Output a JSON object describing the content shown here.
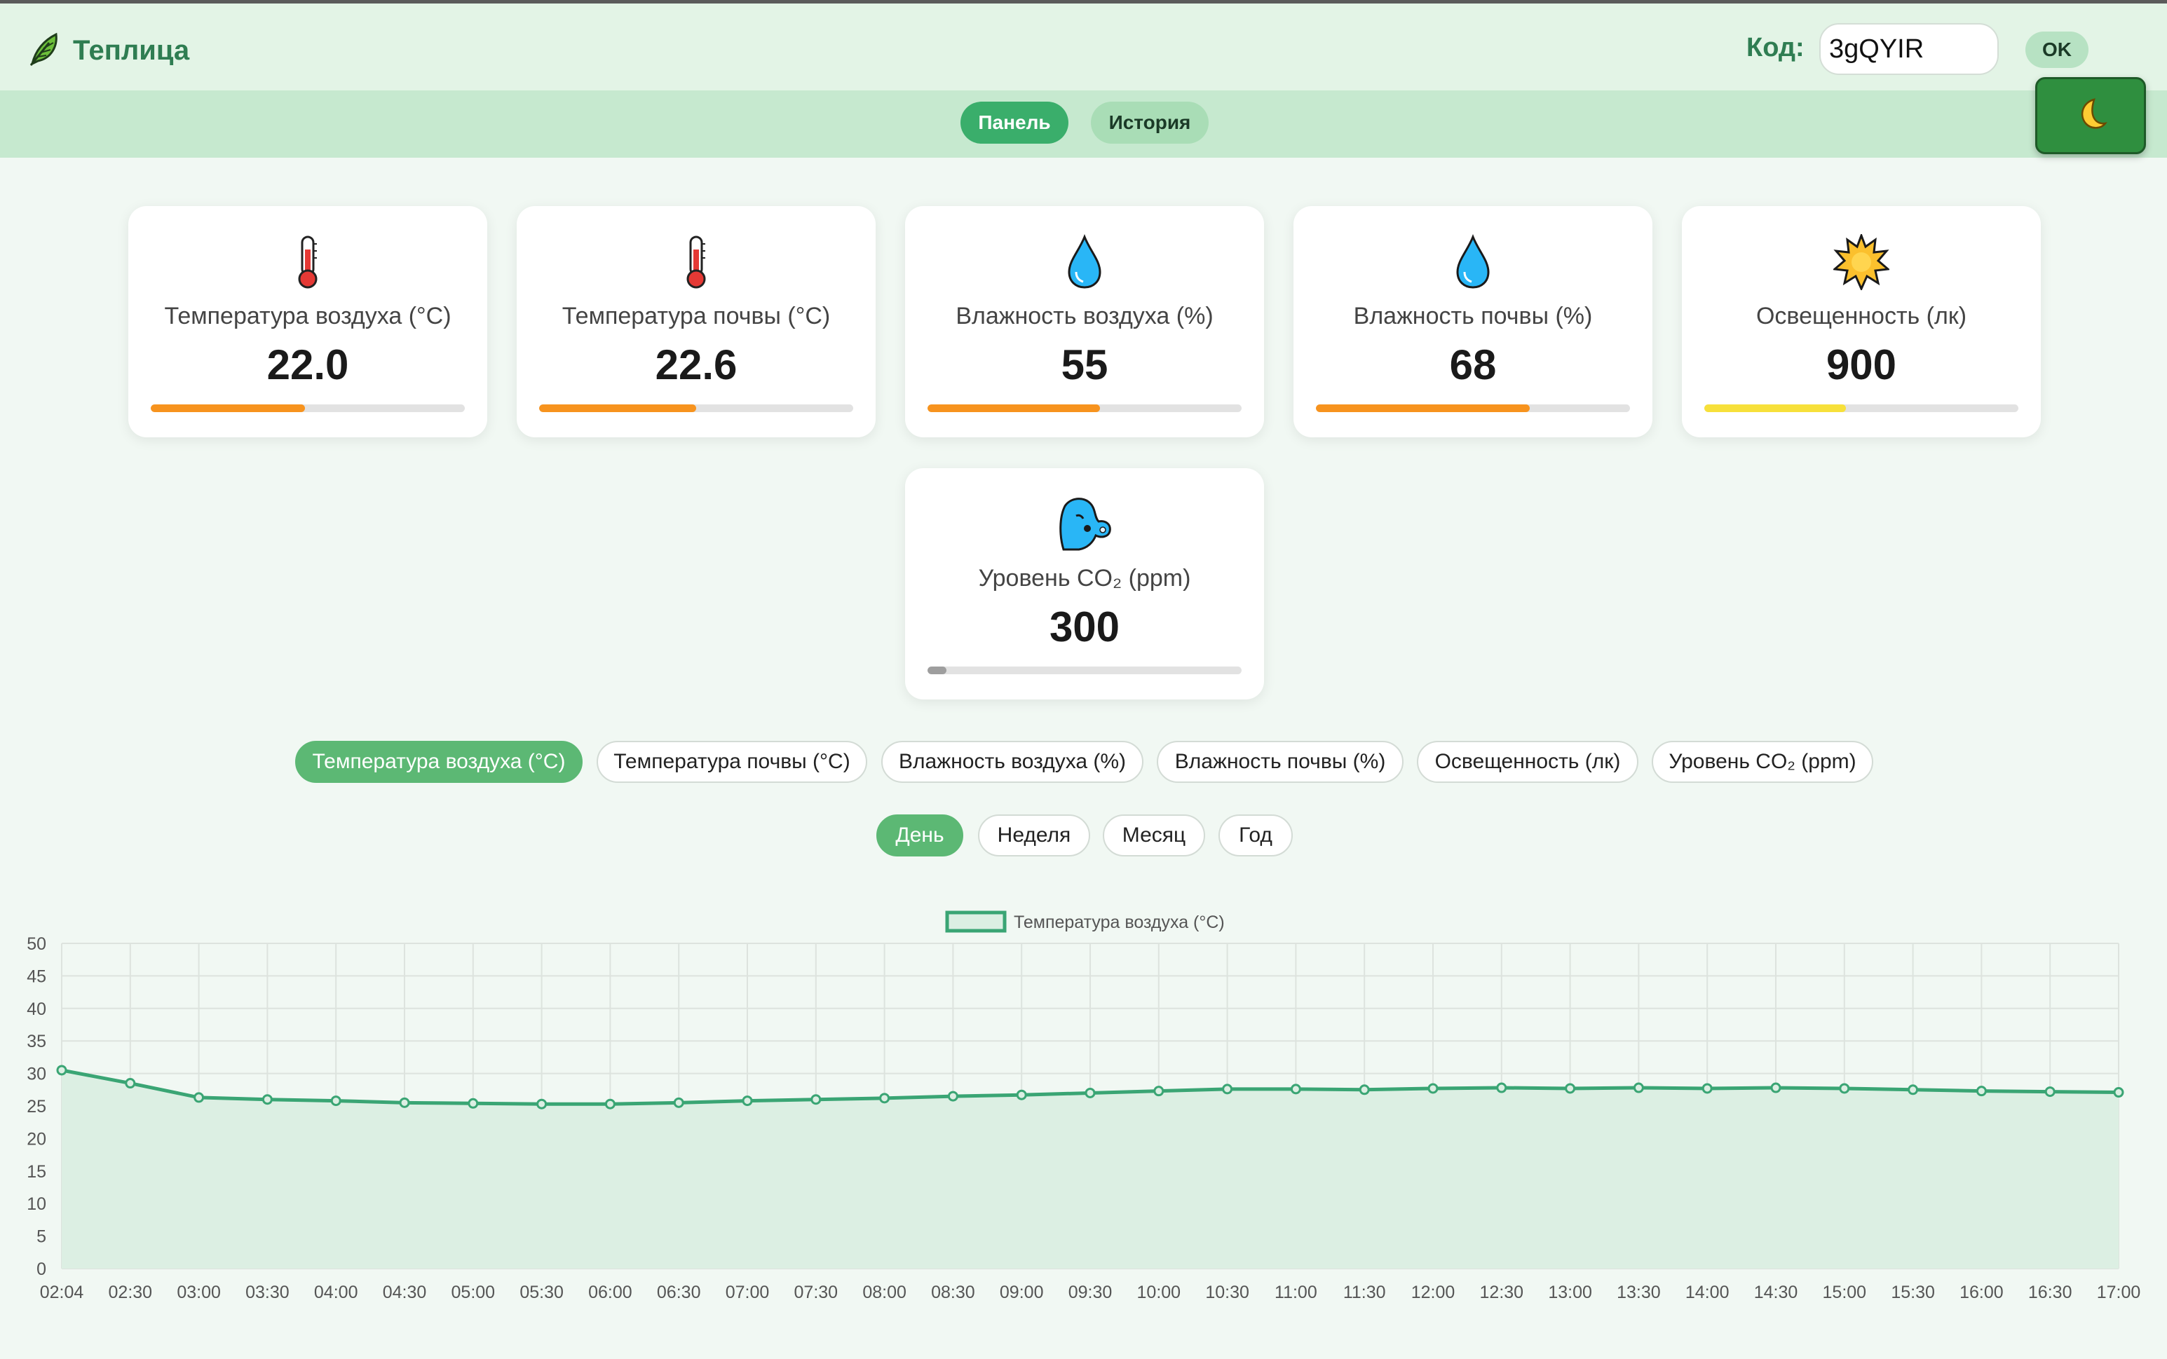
{
  "header": {
    "title": "Теплица",
    "logo_icon": "leaf-icon",
    "code_label": "Код:",
    "code_value": "3gQYIR",
    "ok_label": "OK",
    "theme_icon": "moon-icon"
  },
  "nav": {
    "tabs": [
      {
        "label": "Панель",
        "active": true
      },
      {
        "label": "История",
        "active": false
      }
    ]
  },
  "cards": [
    {
      "label": "Температура воздуха (°C)",
      "value": "22.0",
      "icon": "thermometer-icon",
      "fill_fraction": 0.49,
      "bar_color": "#f7931e"
    },
    {
      "label": "Температура почвы (°C)",
      "value": "22.6",
      "icon": "thermometer-icon",
      "fill_fraction": 0.5,
      "bar_color": "#f7931e"
    },
    {
      "label": "Влажность воздуха (%)",
      "value": "55",
      "icon": "droplet-icon",
      "fill_fraction": 0.55,
      "bar_color": "#f7931e"
    },
    {
      "label": "Влажность почвы (%)",
      "value": "68",
      "icon": "droplet-icon",
      "fill_fraction": 0.68,
      "bar_color": "#f7931e"
    },
    {
      "label": "Освещенность (лк)",
      "value": "900",
      "icon": "sun-icon",
      "fill_fraction": 0.45,
      "bar_color": "#f7e03a"
    },
    {
      "label": "Уровень CO₂ (ppm)",
      "value": "300",
      "icon": "face-exhaling-icon",
      "fill_fraction": 0.06,
      "bar_color": "#9e9e9e"
    }
  ],
  "metric_tabs": [
    {
      "label": "Температура воздуха (°C)",
      "active": true
    },
    {
      "label": "Температура почвы (°C)",
      "active": false
    },
    {
      "label": "Влажность воздуха (%)",
      "active": false
    },
    {
      "label": "Влажность почвы (%)",
      "active": false
    },
    {
      "label": "Освещенность (лк)",
      "active": false
    },
    {
      "label": "Уровень CO₂ (ppm)",
      "active": false
    }
  ],
  "period_tabs": [
    {
      "label": "День",
      "active": true
    },
    {
      "label": "Неделя",
      "active": false
    },
    {
      "label": "Месяц",
      "active": false
    },
    {
      "label": "Год",
      "active": false
    }
  ],
  "colors": {
    "accent": "#3aae6b",
    "line": "#3aa574",
    "area": "#dcefe3"
  },
  "chart_data": {
    "type": "area",
    "legend": "Температура воздуха (°C)",
    "legend_position": "top-center",
    "grid": true,
    "ylim": [
      0,
      50
    ],
    "yticks": [
      0,
      5,
      10,
      15,
      20,
      25,
      30,
      35,
      40,
      45,
      50
    ],
    "x": [
      "02:04",
      "02:30",
      "03:00",
      "03:30",
      "04:00",
      "04:30",
      "05:00",
      "05:30",
      "06:00",
      "06:30",
      "07:00",
      "07:30",
      "08:00",
      "08:30",
      "09:00",
      "09:30",
      "10:00",
      "10:30",
      "11:00",
      "11:30",
      "12:00",
      "12:30",
      "13:00",
      "13:30",
      "14:00",
      "14:30",
      "15:00",
      "15:30",
      "16:00",
      "16:30",
      "17:00"
    ],
    "series": [
      {
        "name": "Температура воздуха (°C)",
        "values": [
          30.5,
          28.5,
          26.3,
          26.0,
          25.8,
          25.5,
          25.4,
          25.3,
          25.3,
          25.5,
          25.8,
          26.0,
          26.2,
          26.5,
          26.7,
          27.0,
          27.3,
          27.6,
          27.6,
          27.5,
          27.7,
          27.8,
          27.7,
          27.8,
          27.7,
          27.8,
          27.7,
          27.5,
          27.3,
          27.2,
          27.1
        ]
      }
    ]
  }
}
